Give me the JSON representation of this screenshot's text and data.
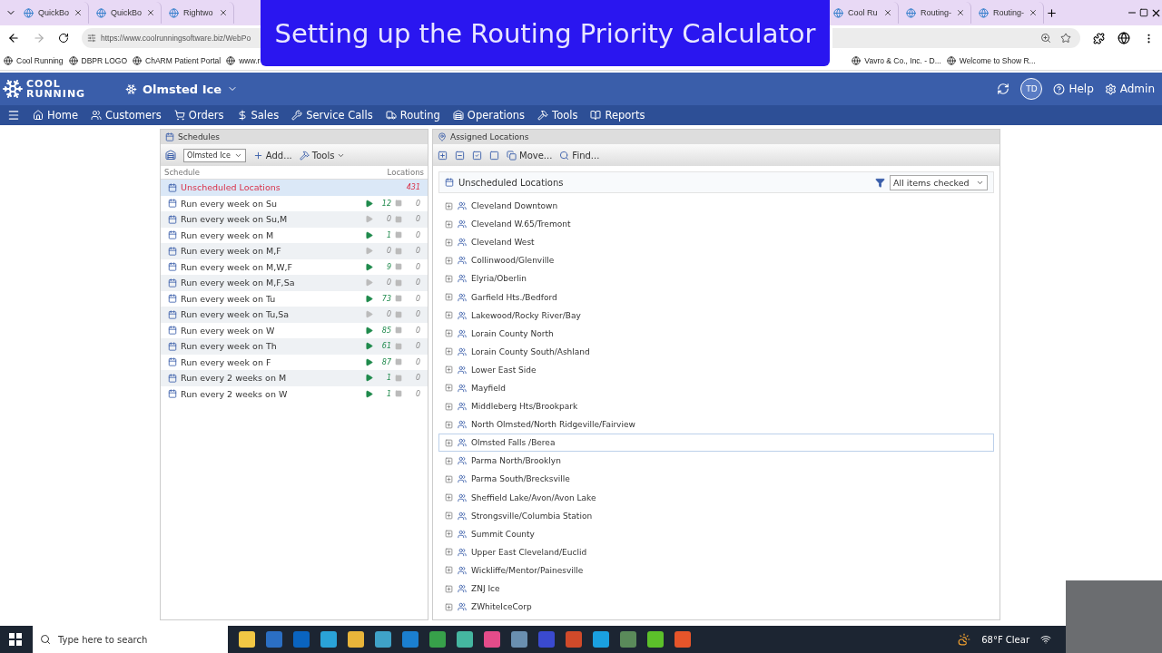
{
  "browser": {
    "tabs": [
      {
        "label": "QuickBo",
        "selected": false
      },
      {
        "label": "QuickBo",
        "selected": false
      },
      {
        "label": "Rightwo",
        "selected": false
      },
      {
        "label": "Cool Ru",
        "selected": false
      },
      {
        "label": "Routing-",
        "selected": false
      },
      {
        "label": "Routing-",
        "selected": false
      }
    ],
    "url": "https://www.coolrunningsoftware.biz/WebPo",
    "bookmarks": [
      "Cool Running",
      "DBPR LOGO",
      "ChARM Patient Portal",
      "www.r",
      "Vavro & Co., Inc. - D...",
      "Welcome to Show R..."
    ]
  },
  "banner": {
    "title": "Setting up the Routing Priority Calculator"
  },
  "app": {
    "logo": [
      "COOL",
      "RUNNING"
    ],
    "company": "Olmsted Ice",
    "avatar": "TD",
    "help": "Help",
    "admin": "Admin"
  },
  "nav": [
    "Home",
    "Customers",
    "Orders",
    "Sales",
    "Service Calls",
    "Routing",
    "Operations",
    "Tools",
    "Reports"
  ],
  "schedules": {
    "title": "Schedules",
    "company_select": "Olmsted Ice",
    "add": "Add...",
    "tools": "Tools",
    "columns": [
      "Schedule",
      "Locations"
    ],
    "rows": [
      {
        "name": "Unscheduled Locations",
        "selected": true,
        "kind": "total",
        "total": "431"
      },
      {
        "name": "Run every week on Su",
        "selected": false,
        "kind": "schedule",
        "active": true,
        "count": "12",
        "inactive_count": "0"
      },
      {
        "name": "Run every week on Su,M",
        "selected": false,
        "kind": "schedule",
        "active": false,
        "count": "0",
        "inactive_count": "0"
      },
      {
        "name": "Run every week on M",
        "selected": false,
        "kind": "schedule",
        "active": true,
        "count": "1",
        "inactive_count": "0"
      },
      {
        "name": "Run every week on M,F",
        "selected": false,
        "kind": "schedule",
        "active": false,
        "count": "0",
        "inactive_count": "0"
      },
      {
        "name": "Run every week on M,W,F",
        "selected": false,
        "kind": "schedule",
        "active": true,
        "count": "9",
        "inactive_count": "0"
      },
      {
        "name": "Run every week on M,F,Sa",
        "selected": false,
        "kind": "schedule",
        "active": false,
        "count": "0",
        "inactive_count": "0"
      },
      {
        "name": "Run every week on Tu",
        "selected": false,
        "kind": "schedule",
        "active": true,
        "count": "73",
        "inactive_count": "0"
      },
      {
        "name": "Run every week on Tu,Sa",
        "selected": false,
        "kind": "schedule",
        "active": false,
        "count": "0",
        "inactive_count": "0"
      },
      {
        "name": "Run every week on W",
        "selected": false,
        "kind": "schedule",
        "active": true,
        "count": "85",
        "inactive_count": "0"
      },
      {
        "name": "Run every week on Th",
        "selected": false,
        "kind": "schedule",
        "active": true,
        "count": "61",
        "inactive_count": "0"
      },
      {
        "name": "Run every week on F",
        "selected": false,
        "kind": "schedule",
        "active": true,
        "count": "87",
        "inactive_count": "0"
      },
      {
        "name": "Run every 2 weeks on M",
        "selected": false,
        "kind": "schedule",
        "active": true,
        "count": "1",
        "inactive_count": "0"
      },
      {
        "name": "Run every 2 weeks on W",
        "selected": false,
        "kind": "schedule",
        "active": true,
        "count": "1",
        "inactive_count": "0"
      }
    ]
  },
  "assigned": {
    "title": "Assigned Locations",
    "move": "Move...",
    "find": "Find...",
    "group": "Unscheduled Locations",
    "filter": "All items checked",
    "locations": [
      {
        "name": "Cleveland Downtown",
        "selected": false
      },
      {
        "name": "Cleveland W.65/Tremont",
        "selected": false
      },
      {
        "name": "Cleveland West",
        "selected": false
      },
      {
        "name": "Collinwood/Glenville",
        "selected": false
      },
      {
        "name": "Elyria/Oberlin",
        "selected": false
      },
      {
        "name": "Garfield Hts./Bedford",
        "selected": false
      },
      {
        "name": "Lakewood/Rocky River/Bay",
        "selected": false
      },
      {
        "name": "Lorain County North",
        "selected": false
      },
      {
        "name": "Lorain County South/Ashland",
        "selected": false
      },
      {
        "name": "Lower East Side",
        "selected": false
      },
      {
        "name": "Mayfield",
        "selected": false
      },
      {
        "name": "Middleberg Hts/Brookpark",
        "selected": false
      },
      {
        "name": "North Olmsted/North Ridgeville/Fairview",
        "selected": false
      },
      {
        "name": "Olmsted Falls /Berea",
        "selected": true
      },
      {
        "name": "Parma North/Brooklyn",
        "selected": false
      },
      {
        "name": "Parma South/Brecksville",
        "selected": false
      },
      {
        "name": "Sheffield Lake/Avon/Avon Lake",
        "selected": false
      },
      {
        "name": "Strongsville/Columbia Station",
        "selected": false
      },
      {
        "name": "Summit County",
        "selected": false
      },
      {
        "name": "Upper East Cleveland/Euclid",
        "selected": false
      },
      {
        "name": "Wickliffe/Mentor/Painesville",
        "selected": false
      },
      {
        "name": "ZNJ Ice",
        "selected": false
      },
      {
        "name": "ZWhiteIceCorp",
        "selected": false
      }
    ]
  },
  "taskbar": {
    "search_placeholder": "Type here to search",
    "weather": "68°F Clear"
  }
}
